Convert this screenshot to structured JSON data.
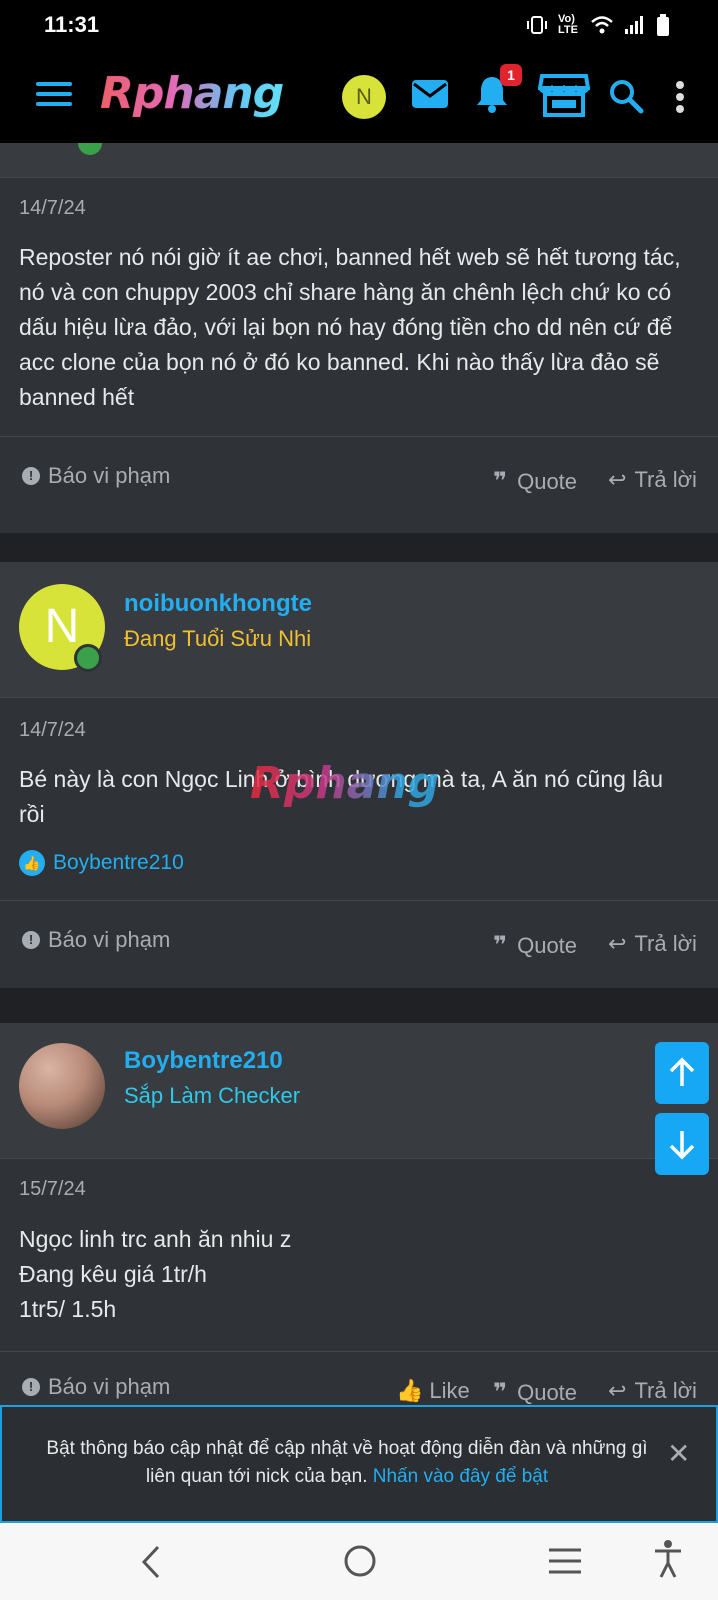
{
  "status_bar": {
    "time": "11:31",
    "signal_text": "Vo) LTE"
  },
  "app_bar": {
    "logo_text": "Rphang",
    "avatar_initial": "N",
    "notification_count": "1"
  },
  "posts": [
    {
      "date": "14/7/24",
      "body": "Reposter nó nói giờ ít ae chơi, banned hết web sẽ hết tương tác, nó và con chuppy 2003 chỉ share hàng ăn chênh lệch chứ ko có dấu hiệu lừa đảo, với lại bọn nó hay đóng tiền cho dd nên cứ để acc clone của bọn nó ở đó ko banned. Khi nào thấy lừa đảo sẽ banned hết",
      "report_label": "Báo vi phạm",
      "quote_label": "Quote",
      "reply_label": "Trả lời"
    },
    {
      "username": "noibuonkhongte",
      "user_title": "Đang Tuổi Sửu Nhi",
      "user_title_color": "#f0c030",
      "avatar_initial": "N",
      "date": "14/7/24",
      "body": "Bé này là con Ngọc Linh ở bình dương mà ta, A ăn nó cũng lâu rồi",
      "liked_by": "Boybentre210",
      "report_label": "Báo vi phạm",
      "quote_label": "Quote",
      "reply_label": "Trả lời"
    },
    {
      "username": "Boybentre210",
      "user_title": "Sắp Làm Checker",
      "user_title_color": "#2ec8e8",
      "date": "15/7/24",
      "body_lines": [
        "Ngọc linh trc anh ăn nhiu z",
        "Đang kêu giá 1tr/h",
        "1tr5/ 1.5h"
      ],
      "report_label": "Báo vi phạm",
      "like_label": "Like",
      "quote_label": "Quote",
      "reply_label": "Trả lời"
    }
  ],
  "watermark": "Rphang",
  "notification_banner": {
    "message": "Bật thông báo cập nhật để cập nhật về hoạt động diễn đàn và những gì liên quan tới nick của bạn.",
    "link_text": "Nhấn vào đây để bật"
  },
  "colors": {
    "accent": "#22aef0",
    "background": "#2f3236",
    "header_bg": "#000000"
  }
}
